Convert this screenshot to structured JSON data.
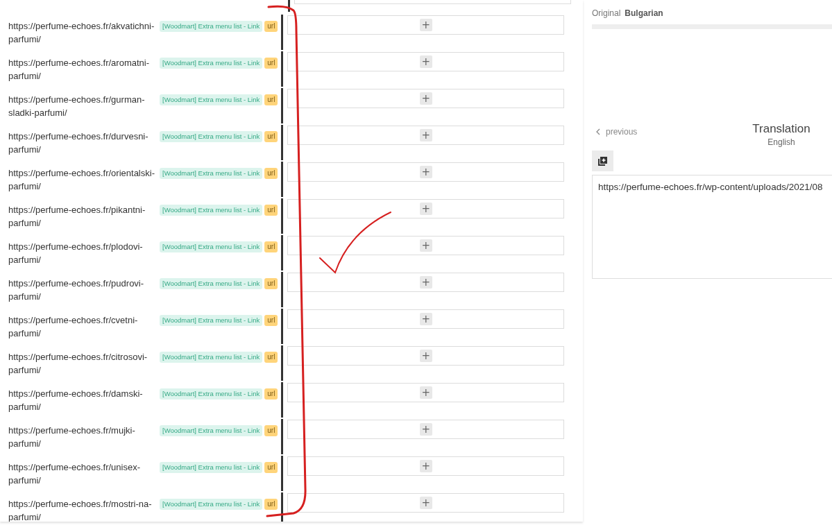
{
  "rows": [
    {
      "url": "https://perfume-echoes.fr/akvatichni-parfumi/",
      "tag": "[Woodmart] Extra menu list - Link",
      "type": "url",
      "button": "+"
    },
    {
      "url": "https://perfume-echoes.fr/aromatni-parfumi/",
      "tag": "[Woodmart] Extra menu list - Link",
      "type": "url",
      "button": "+"
    },
    {
      "url": "https://perfume-echoes.fr/gurman-sladki-parfumi/",
      "tag": "[Woodmart] Extra menu list - Link",
      "type": "url",
      "button": "+"
    },
    {
      "url": "https://perfume-echoes.fr/durvesni-parfumi/",
      "tag": "[Woodmart] Extra menu list - Link",
      "type": "url",
      "button": "+"
    },
    {
      "url": "https://perfume-echoes.fr/orientalski-parfumi/",
      "tag": "[Woodmart] Extra menu list - Link",
      "type": "url",
      "button": "+"
    },
    {
      "url": "https://perfume-echoes.fr/pikantni-parfumi/",
      "tag": "[Woodmart] Extra menu list - Link",
      "type": "url",
      "button": "+"
    },
    {
      "url": "https://perfume-echoes.fr/plodovi-parfumi/",
      "tag": "[Woodmart] Extra menu list - Link",
      "type": "url",
      "button": "+"
    },
    {
      "url": "https://perfume-echoes.fr/pudrovi-parfumi/",
      "tag": "[Woodmart] Extra menu list - Link",
      "type": "url",
      "button": "+"
    },
    {
      "url": "https://perfume-echoes.fr/cvetni-parfumi/",
      "tag": "[Woodmart] Extra menu list - Link",
      "type": "url",
      "button": "+"
    },
    {
      "url": "https://perfume-echoes.fr/citrosovi-parfumi/",
      "tag": "[Woodmart] Extra menu list - Link",
      "type": "url",
      "button": "+"
    },
    {
      "url": "https://perfume-echoes.fr/damski-parfumi/",
      "tag": "[Woodmart] Extra menu list - Link",
      "type": "url",
      "button": "+"
    },
    {
      "url": "https://perfume-echoes.fr/mujki-parfumi/",
      "tag": "[Woodmart] Extra menu list - Link",
      "type": "url",
      "button": "+"
    },
    {
      "url": "https://perfume-echoes.fr/unisex-parfumi/",
      "tag": "[Woodmart] Extra menu list - Link",
      "type": "url",
      "button": "+"
    },
    {
      "url": "https://perfume-echoes.fr/mostri-na-parfumi/",
      "tag": "[Woodmart] Extra menu list - Link",
      "type": "url",
      "button": "+"
    }
  ],
  "editor": {
    "original_label": "Original",
    "original_language": "Bulgarian",
    "previous": "previous",
    "translation_title": "Translation",
    "translation_language": "English",
    "translation_value": "https://perfume-echoes.fr/wp-content/uploads/2021/08"
  }
}
